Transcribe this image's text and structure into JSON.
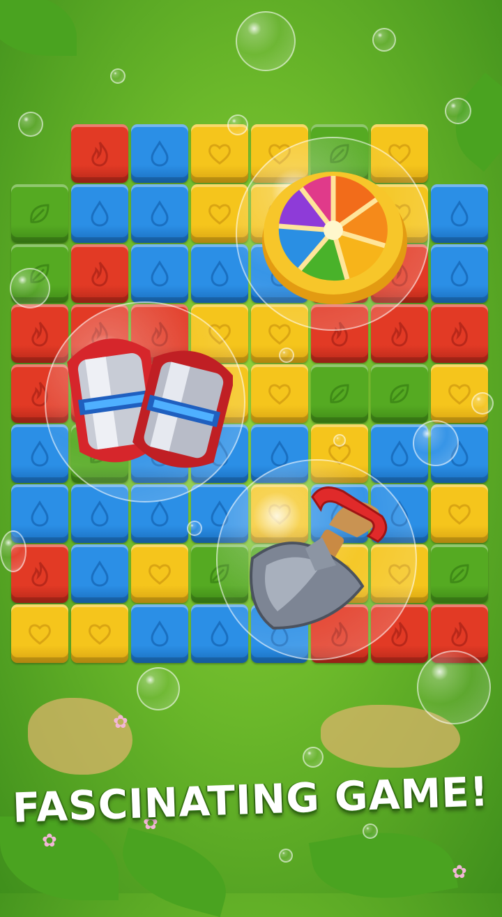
{
  "tagline": "FASCINATING GAME!",
  "colors": {
    "red": "#e23a25",
    "blue": "#2b8fe6",
    "yellow": "#f5c51c",
    "green": "#55aa22",
    "grass": "#6bb82a"
  },
  "icons": {
    "red": "flame-icon",
    "blue": "water-drop-icon",
    "yellow": "heart-icon",
    "green": "leaf-icon"
  },
  "board": {
    "columns": 8,
    "rows": [
      [
        "",
        "red",
        "blue",
        "yellow",
        "yellow",
        "green",
        "yellow",
        ""
      ],
      [
        "green",
        "blue",
        "blue",
        "yellow",
        "yellow",
        "yellow",
        "yellow",
        "blue"
      ],
      [
        "green",
        "red",
        "blue",
        "blue",
        "blue",
        "red",
        "red",
        "blue"
      ],
      [
        "red",
        "red",
        "red",
        "yellow",
        "yellow",
        "red",
        "red",
        "red"
      ],
      [
        "red",
        "red",
        "yellow",
        "yellow",
        "yellow",
        "green",
        "green",
        "yellow"
      ],
      [
        "blue",
        "green",
        "blue",
        "blue",
        "blue",
        "yellow",
        "blue",
        "blue"
      ],
      [
        "blue",
        "blue",
        "blue",
        "blue",
        "yellow",
        "blue",
        "blue",
        "yellow"
      ],
      [
        "red",
        "blue",
        "yellow",
        "green",
        "green",
        "yellow",
        "yellow",
        "green"
      ],
      [
        "yellow",
        "yellow",
        "blue",
        "blue",
        "blue",
        "red",
        "red",
        "red"
      ]
    ]
  },
  "boosters": [
    {
      "name": "rainbow-orange-booster-icon"
    },
    {
      "name": "rocket-booster-icon"
    },
    {
      "name": "shovel-booster-icon"
    }
  ]
}
